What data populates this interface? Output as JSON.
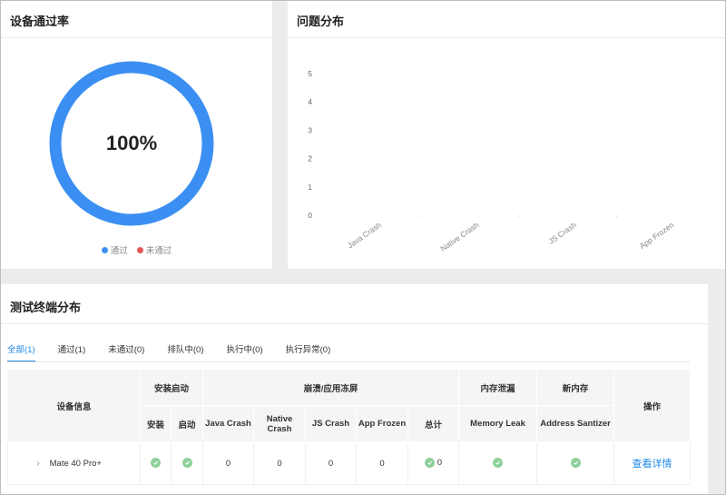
{
  "pass_card": {
    "title": "设备通过率",
    "center_text": "100%",
    "legend": [
      {
        "label": "通过",
        "color": "#3b8ff2"
      },
      {
        "label": "未通过",
        "color": "#e55656"
      }
    ]
  },
  "issue_card": {
    "title": "问题分布"
  },
  "terminal_card": {
    "title": "测试终端分布",
    "tabs": [
      {
        "label": "全部(1)",
        "active": true
      },
      {
        "label": "通过(1)",
        "active": false
      },
      {
        "label": "未通过(0)",
        "active": false
      },
      {
        "label": "排队中(0)",
        "active": false
      },
      {
        "label": "执行中(0)",
        "active": false
      },
      {
        "label": "执行异常(0)",
        "active": false
      }
    ],
    "table": {
      "device_info": "设备信息",
      "install_start": "安装启动",
      "install": "安装",
      "start": "启动",
      "crash_group": "崩溃/应用冻屏",
      "java_crash": "Java Crash",
      "native_crash": "Native Crash",
      "js_crash": "JS Crash",
      "app_frozen": "App Frozen",
      "total": "总计",
      "memory_leak_group": "内存泄漏",
      "memory_leak": "Memory Leak",
      "new_memory_group": "新内存",
      "address_sanitizer": "Address Santizer",
      "operation": "操作",
      "rows": [
        {
          "expand": "›",
          "device": "Mate 40 Pro+",
          "java_crash": "0",
          "native_crash": "0",
          "js_crash": "0",
          "app_frozen": "0",
          "total": "0",
          "action": "查看详情"
        }
      ]
    }
  },
  "chart_data": {
    "type": "bar",
    "title": "问题分布",
    "categories": [
      "Java Crash",
      "Native Crash",
      "JS Crash",
      "App Frozen"
    ],
    "values": [
      0,
      0,
      0,
      0
    ],
    "y_ticks": [
      "0",
      "1",
      "2",
      "3",
      "4",
      "5"
    ],
    "ylim": [
      0,
      5
    ],
    "grid": false
  },
  "colors": {
    "accent": "#1e88e5",
    "donut": "#3b8ff2",
    "fail": "#e55656",
    "check": "#8ed09a"
  }
}
